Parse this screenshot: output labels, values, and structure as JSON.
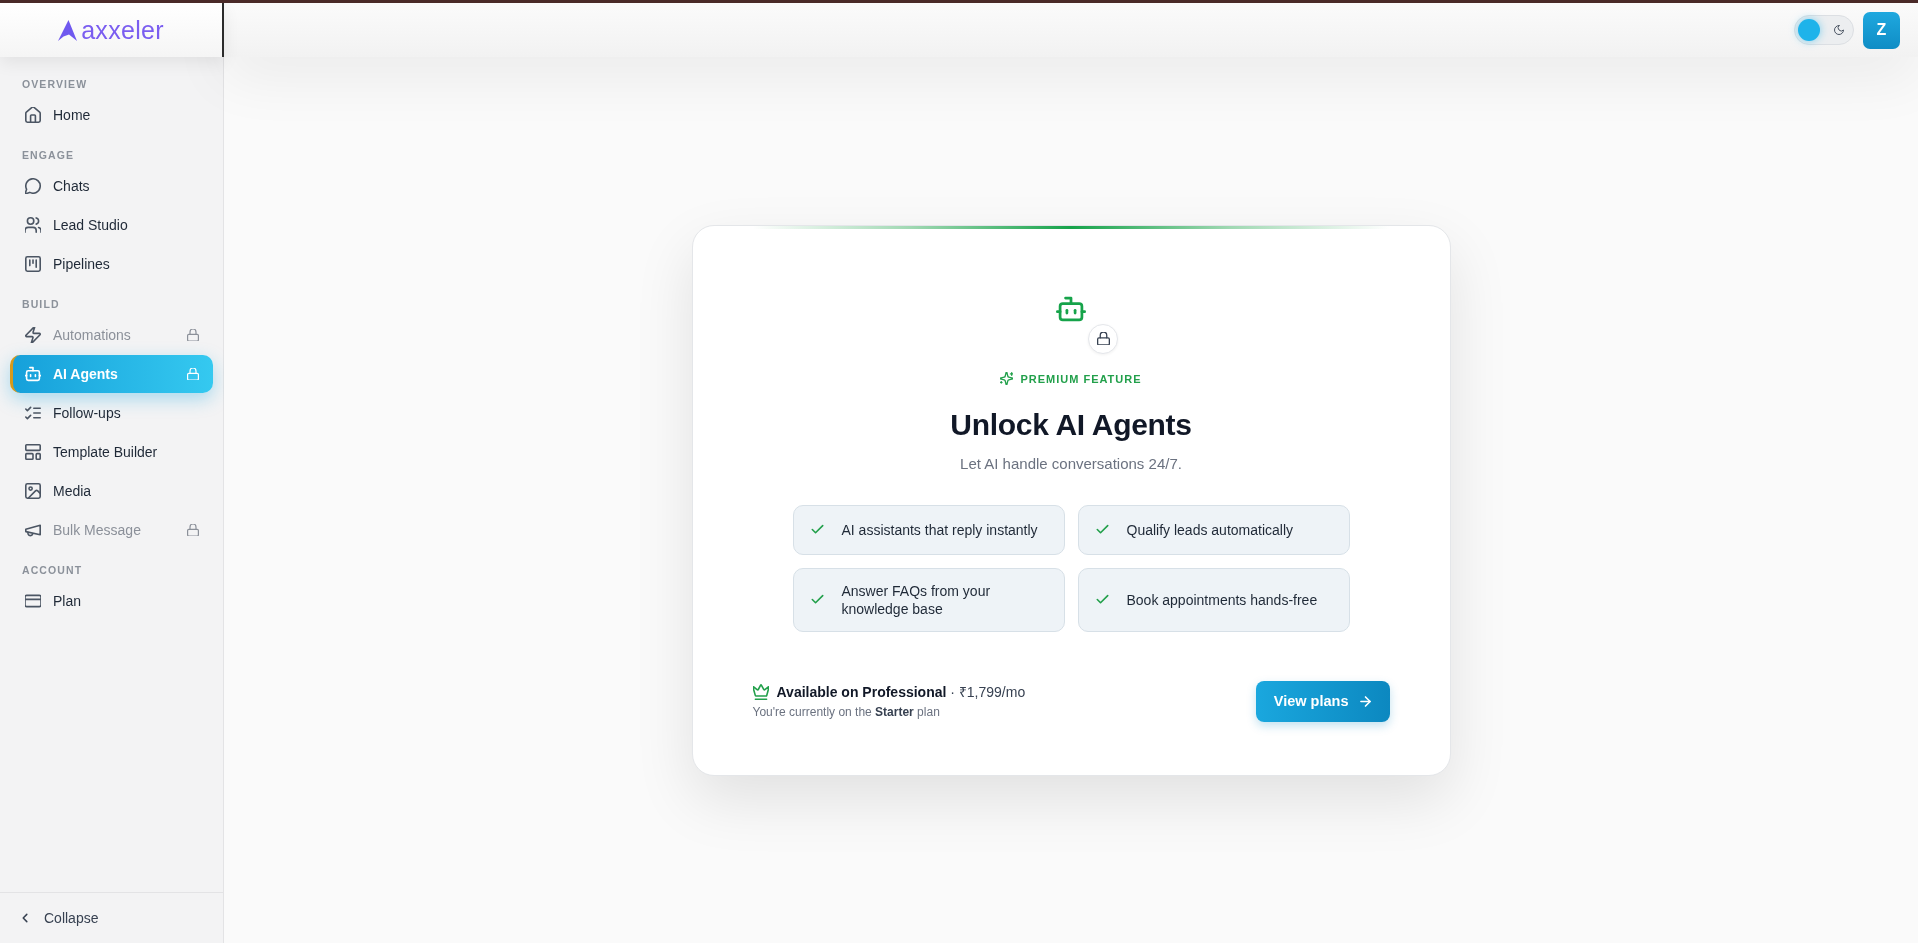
{
  "header": {
    "logo": "axxeler",
    "theme_toggle": {
      "dark_mode": false
    },
    "avatar": "Z"
  },
  "sidebar": {
    "sections": [
      {
        "title": "OVERVIEW",
        "items": [
          {
            "label": "Home",
            "selected": false,
            "locked": false
          }
        ]
      },
      {
        "title": "ENGAGE",
        "items": [
          {
            "label": "Chats",
            "selected": false,
            "locked": false
          },
          {
            "label": "Lead Studio",
            "selected": false,
            "locked": false
          },
          {
            "label": "Pipelines",
            "selected": false,
            "locked": false
          }
        ]
      },
      {
        "title": "BUILD",
        "items": [
          {
            "label": "Automations",
            "selected": false,
            "locked": true
          },
          {
            "label": "AI Agents",
            "selected": true,
            "locked": true
          },
          {
            "label": "Follow-ups",
            "selected": false,
            "locked": false
          },
          {
            "label": "Template Builder",
            "selected": false,
            "locked": false
          },
          {
            "label": "Media",
            "selected": false,
            "locked": false
          },
          {
            "label": "Bulk Message",
            "selected": false,
            "locked": true
          }
        ]
      },
      {
        "title": "ACCOUNT",
        "items": [
          {
            "label": "Plan",
            "selected": false,
            "locked": false
          }
        ]
      }
    ],
    "collapse": "Collapse"
  },
  "upgrade_card": {
    "badge": "PREMIUM FEATURE",
    "title": "Unlock AI Agents",
    "subtitle": "Let AI handle conversations 24/7.",
    "features": [
      "AI assistants that reply instantly",
      "Qualify leads automatically",
      "Answer FAQs from your knowledge base",
      "Book appointments hands-free"
    ],
    "availability": "**Available on Professional** · ₹1,799/mo",
    "current_plan": "You're currently on the **Starter** plan",
    "button": "View plans"
  }
}
